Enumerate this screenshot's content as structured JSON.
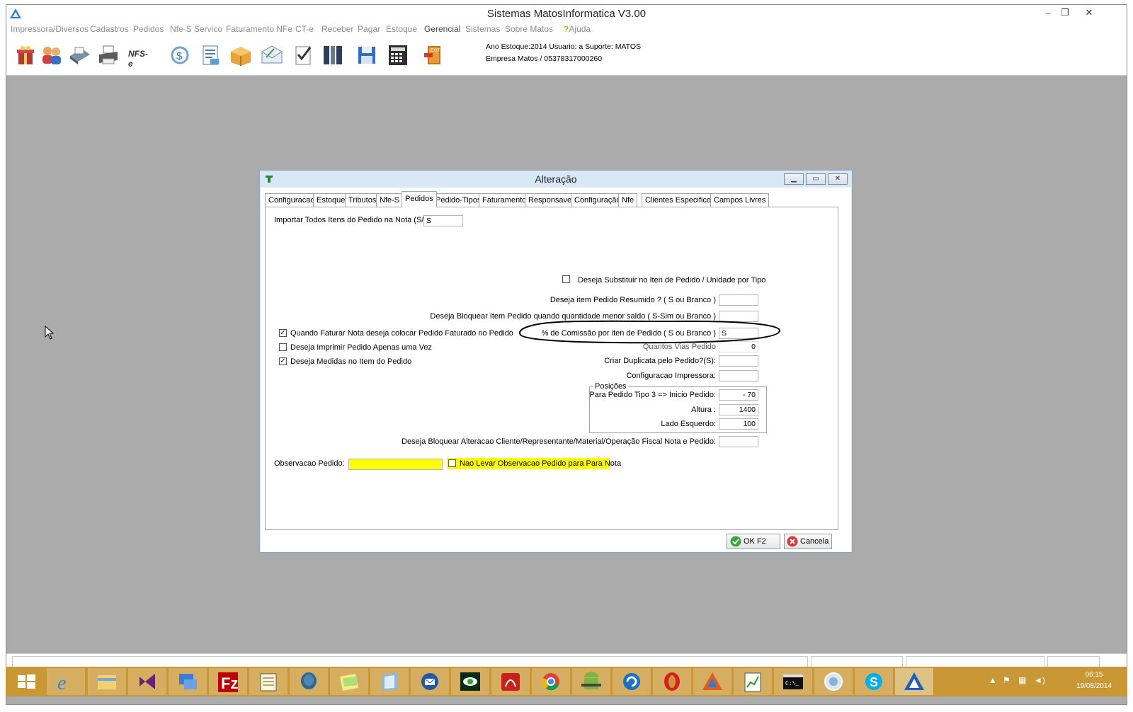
{
  "app": {
    "title": "Sistemas MatosInformatica V3.00",
    "minimize": "–",
    "restore": "❐",
    "close": "✕"
  },
  "menu": [
    "Impressora/Diversos",
    "Cadastros",
    "Pedidos",
    "Nfe-S Servico",
    "Faturamento NFe",
    "CT-e",
    "Receber",
    "Pagar",
    "Estoque",
    "Gerencial",
    "Sistemas",
    "Sobre Matos",
    "Ajuda"
  ],
  "toolbar": {
    "icons": [
      "gift-icon",
      "users-icon",
      "scanner-icon",
      "printer-icon",
      "nfse-icon",
      "dollar-icon",
      "document-icon",
      "package-icon",
      "mail-icon",
      "checklist-icon",
      "tools-icon",
      "save-icon",
      "calculator-icon",
      "exit-icon"
    ],
    "nfse_label": "NFS-e",
    "info_line1": "Ano Estoque:2014 Usuario: a Suporte: MATOS",
    "info_line2": "Empresa Matos / 05378317000260"
  },
  "dialog": {
    "title": "Alteração",
    "tabs": [
      "Configuracao",
      "Estoque",
      "Tributos",
      "Nfe-S",
      "Pedidos",
      "Pedido-Tipos",
      "Faturamento",
      "Responsavel",
      "Configuração",
      "Nfe",
      "Clientes Especificos",
      "Campos Livres"
    ],
    "active_tab": "Pedidos",
    "fields": {
      "importar_label": "Importar Todos Itens do Pedido na Nota (S/N)",
      "importar_value": "S",
      "substituir_label": "Deseja Substituir no Iten de Pedido / Unidade por Tipo",
      "resumido_label": "Deseja item Pedido Resumido ? ( S ou Branco )",
      "resumido_value": "",
      "bloquear_label": "Deseja Bloquear Item Pedido quando quantidade menor saldo ( S-Sim  ou Branco )",
      "bloquear_value": "",
      "quando_faturar_label": "Quando Faturar Nota deseja colocar Pedido Faturado no Pedido",
      "imprimir_label": "Deseja Imprimir Pedido Apenas uma Vez",
      "medidas_label": "Deseja Medidas no Item do Pedido",
      "comissao_label": "% de Comissão por iten de Pedido ( S ou Branco )",
      "comissao_value": "S",
      "vias_label": "Quantos Vias Pedido",
      "vias_value": "0",
      "duplicata_label": "Criar Duplicata pelo Pedido?(S):",
      "duplicata_value": "",
      "config_impressora_label": "Configuracao Impressora:",
      "config_impressora_value": "",
      "posicoes_label": "Posições",
      "tipo3_label": "Para Pedido Tipo 3 => Inicio Pedido:",
      "tipo3_value": "-    70",
      "altura_label": "Altura :",
      "altura_value": "1400",
      "lado_label": "Lado Esquerdo:",
      "lado_value": "100",
      "bloquear_alteracao_label": "Deseja Bloquear Alteracao Cliente/Representante/Material/Operação Fiscal Nota e Pedido:",
      "bloquear_alteracao_value": "",
      "observacao_label": "Observacao Pedido:",
      "observacao_value": "",
      "nao_levar_label": "Nao Levar Observacao Pedido para  Para Nota"
    },
    "checks": {
      "substituir": false,
      "quando_faturar": true,
      "imprimir": false,
      "medidas": true,
      "nao_levar": false
    },
    "ok_label": "OK F2",
    "cancel_label": "Cancela"
  },
  "taskbar": {
    "apps": [
      "windows-start-icon",
      "internet-explorer-icon",
      "file-explorer-icon",
      "visual-studio-icon",
      "remote-desktop-icon",
      "filezilla-icon",
      "notepad-icon",
      "postgresql-icon",
      "sticky-notes-icon",
      "word-icon",
      "thunderbird-icon",
      "eye-app-icon",
      "acrobat-icon",
      "chrome-icon",
      "android-icon",
      "refresh-app-icon",
      "opera-icon",
      "matos-app-icon",
      "chart-app-icon",
      "cmd-icon",
      "globe-icon",
      "skype-icon",
      "matos-active-icon"
    ],
    "time": "06:15",
    "date": "19/08/2014"
  },
  "colors": {
    "taskbar": "#c99835",
    "workspace": "#ababab",
    "highlight_yellow": "#ffff00"
  }
}
